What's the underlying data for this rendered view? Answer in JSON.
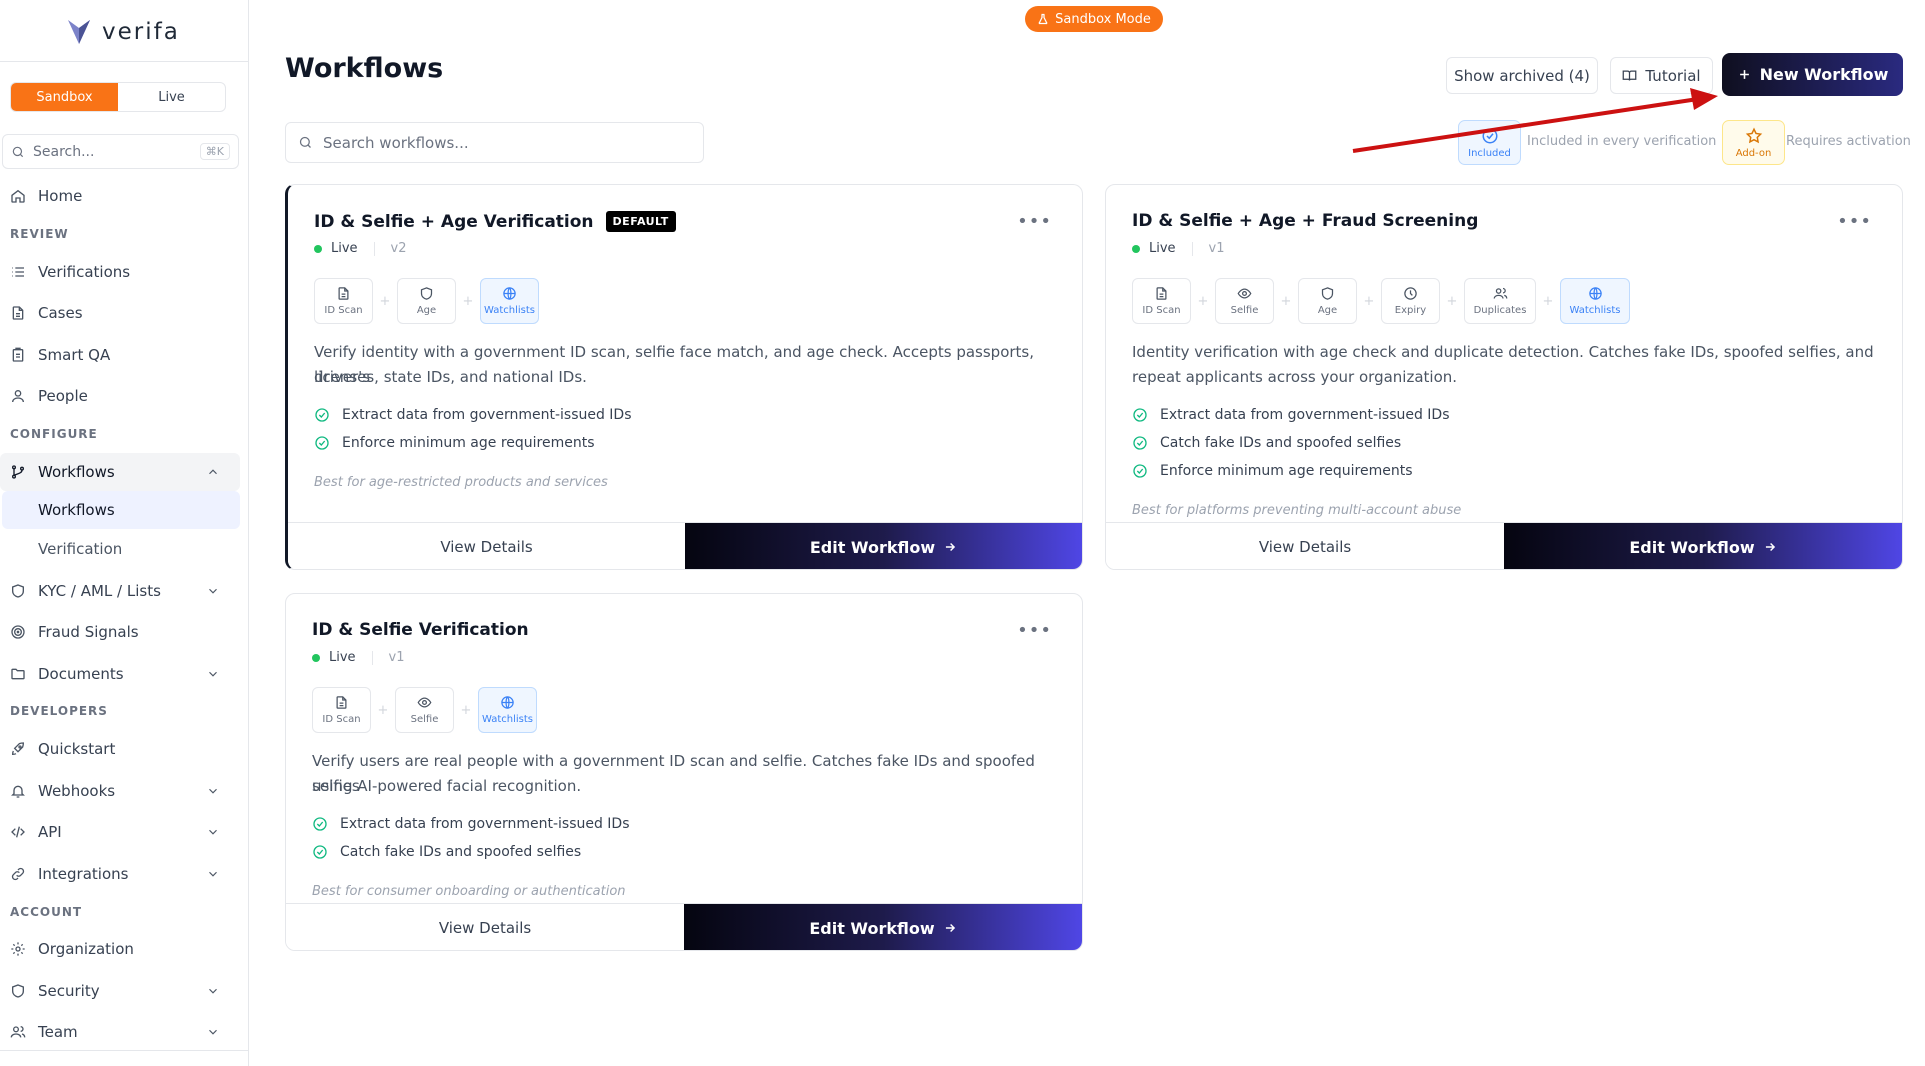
{
  "app": {
    "name": "verifa",
    "sandbox_pill": "Sandbox Mode"
  },
  "sidebar": {
    "mode": {
      "sandbox": "Sandbox",
      "live": "Live",
      "active": "Sandbox"
    },
    "search": {
      "placeholder": "Search...",
      "shortcut": "⌘K"
    },
    "items": {
      "home": "Home",
      "review_section": "REVIEW",
      "verifications": "Verifications",
      "cases": "Cases",
      "smart_qa": "Smart QA",
      "people": "People",
      "configure_section": "CONFIGURE",
      "workflows": "Workflows",
      "workflows_sub": "Workflows",
      "verification_sub": "Verification",
      "kyc": "KYC / AML / Lists",
      "fraud": "Fraud Signals",
      "documents": "Documents",
      "developers_section": "DEVELOPERS",
      "quickstart": "Quickstart",
      "webhooks": "Webhooks",
      "api": "API",
      "integrations": "Integrations",
      "account_section": "ACCOUNT",
      "organization": "Organization",
      "security": "Security",
      "team": "Team"
    }
  },
  "header": {
    "title": "Workflows",
    "show_archived": "Show archived (4)",
    "tutorial": "Tutorial",
    "new_workflow": "New Workflow",
    "search_placeholder": "Search workflows..."
  },
  "legend": {
    "included_badge": "Included",
    "included_text": "Included in every verification",
    "addon_badge": "Add-on",
    "addon_text": "Requires activation"
  },
  "cards": [
    {
      "title": "ID & Selfie + Age Verification",
      "badge": "DEFAULT",
      "status": "Live",
      "version": "v2",
      "checks": [
        "ID Scan",
        "Age",
        "Watchlists"
      ],
      "description_1": "Verify identity with a government ID scan, selfie face match, and age check. Accepts passports, driver's",
      "description_2": "licenses, state IDs, and national IDs.",
      "features": [
        "Extract data from government-issued IDs",
        "Enforce minimum age requirements"
      ],
      "best_for": "Best for age-restricted products and services",
      "view": "View Details",
      "edit": "Edit Workflow"
    },
    {
      "title": "ID & Selfie + Age + Fraud Screening",
      "status": "Live",
      "version": "v1",
      "checks": [
        "ID Scan",
        "Selfie",
        "Age",
        "Expiry",
        "Duplicates",
        "Watchlists"
      ],
      "description_1": "Identity verification with age check and duplicate detection. Catches fake IDs, spoofed selfies, and",
      "description_2": "repeat applicants across your organization.",
      "features": [
        "Extract data from government-issued IDs",
        "Catch fake IDs and spoofed selfies",
        "Enforce minimum age requirements"
      ],
      "best_for": "Best for platforms preventing multi-account abuse",
      "view": "View Details",
      "edit": "Edit Workflow"
    },
    {
      "title": "ID & Selfie Verification",
      "status": "Live",
      "version": "v1",
      "checks": [
        "ID Scan",
        "Selfie",
        "Watchlists"
      ],
      "description_1": "Verify users are real people with a government ID scan and selfie. Catches fake IDs and spoofed selfies",
      "description_2": "using AI-powered facial recognition.",
      "features": [
        "Extract data from government-issued IDs",
        "Catch fake IDs and spoofed selfies"
      ],
      "best_for": "Best for consumer onboarding or authentication",
      "view": "View Details",
      "edit": "Edit Workflow"
    }
  ],
  "colors": {
    "accent_orange": "#f97316",
    "dark_button": "#0f0f1f",
    "included_blue": "#3b82f6",
    "addon_amber": "#d97706",
    "live_green": "#22c55e",
    "arrow_red": "#cc1111"
  }
}
